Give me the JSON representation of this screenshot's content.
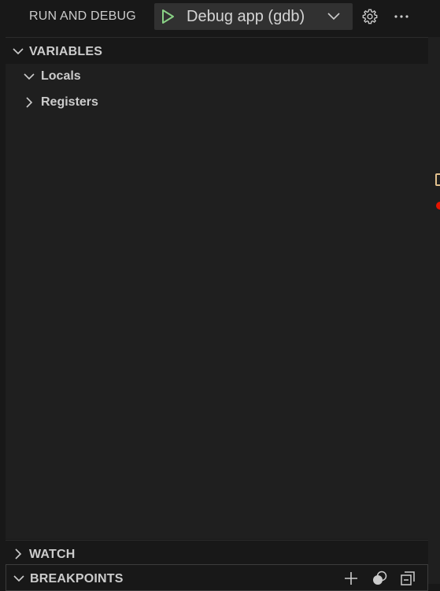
{
  "header": {
    "title": "RUN AND DEBUG",
    "config_label": "Debug app (gdb)",
    "play_icon": "play-icon",
    "dropdown_icon": "chevron-down-icon",
    "settings_icon": "gear-icon",
    "more_icon": "more-actions-icon"
  },
  "sections": {
    "variables": {
      "title": "VARIABLES",
      "expanded": true,
      "scopes": [
        {
          "label": "Locals",
          "expanded": true
        },
        {
          "label": "Registers",
          "expanded": false
        }
      ]
    },
    "watch": {
      "title": "WATCH",
      "expanded": false
    },
    "breakpoints": {
      "title": "BREAKPOINTS",
      "expanded": true,
      "actions": [
        "add-icon",
        "toggle-breakpoints-icon",
        "collapse-all-icon"
      ]
    }
  },
  "colors": {
    "background": "#181818",
    "panel": "#1f1f1f",
    "text": "#cccccc",
    "play_green": "#89d185",
    "breakpoint_red": "#e51400",
    "current_line_yellow": "#e2c08d"
  }
}
